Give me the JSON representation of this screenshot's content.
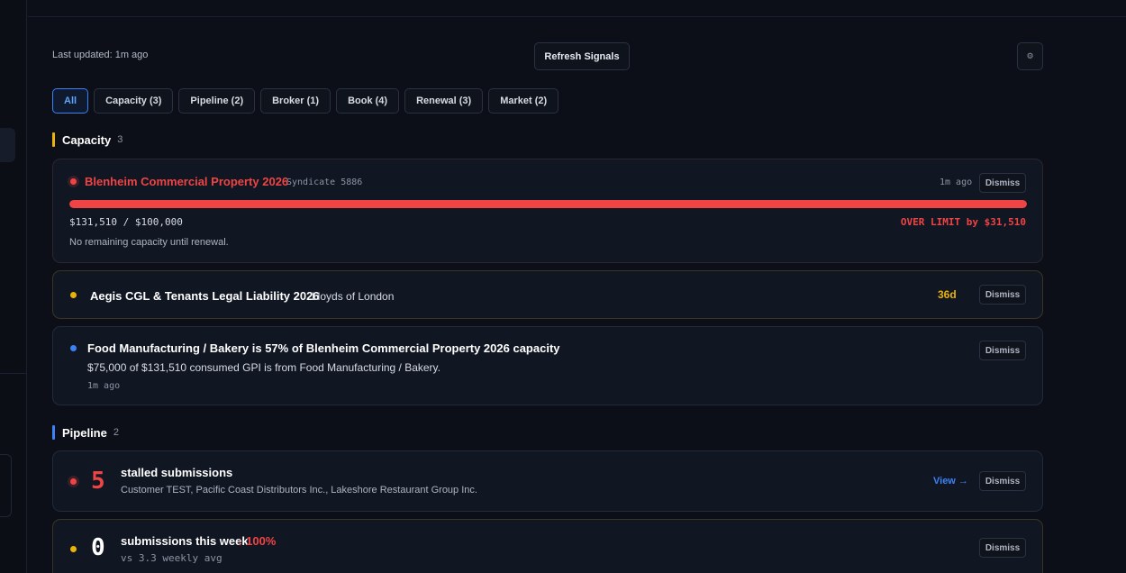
{
  "toolbar": {
    "last_updated": "Last updated: 1m ago",
    "refresh_label": "Refresh Signals",
    "settings_icon": "⚙"
  },
  "filters": [
    {
      "label": "All",
      "active": true
    },
    {
      "label": "Capacity (3)",
      "active": false
    },
    {
      "label": "Pipeline (2)",
      "active": false
    },
    {
      "label": "Broker (1)",
      "active": false
    },
    {
      "label": "Book (4)",
      "active": false
    },
    {
      "label": "Renewal (3)",
      "active": false
    },
    {
      "label": "Market (2)",
      "active": false
    }
  ],
  "sections": {
    "capacity": {
      "title": "Capacity",
      "count": "3",
      "color": "#eab308"
    },
    "pipeline": {
      "title": "Pipeline",
      "count": "2",
      "color": "#3b82f6"
    }
  },
  "cards": {
    "blenheim": {
      "title": "Blenheim Commercial Property 2026",
      "syndicate": "Syndicate 5886",
      "time": "1m ago",
      "usage": "$131,510 / $100,000",
      "over_limit": "OVER LIMIT by $31,510",
      "note": "No remaining capacity until renewal.",
      "progress": 1.0,
      "dismiss": "Dismiss"
    },
    "aegis": {
      "title": "Aegis CGL & Tenants Legal Liability 2026",
      "market": "Lloyds of London",
      "days": "36d",
      "dismiss": "Dismiss"
    },
    "food": {
      "title": "Food Manufacturing / Bakery is 57% of Blenheim Commercial Property 2026 capacity",
      "detail": "$75,000 of $131,510 consumed GPI is from Food Manufacturing / Bakery.",
      "time": "1m ago",
      "dismiss": "Dismiss"
    },
    "stalled": {
      "number": "5",
      "title": "stalled submissions",
      "detail": "Customer TEST, Pacific Coast Distributors Inc., Lakeshore Restaurant Group Inc.",
      "view": "View →",
      "dismiss": "Dismiss"
    },
    "weekly": {
      "number": "0",
      "title": "submissions this week",
      "change": "↓ 100%",
      "detail": "vs 3.3 weekly avg",
      "dismiss": "Dismiss"
    }
  },
  "colors": {
    "danger": "#ef4444",
    "warning": "#eab308",
    "info": "#3b82f6"
  }
}
